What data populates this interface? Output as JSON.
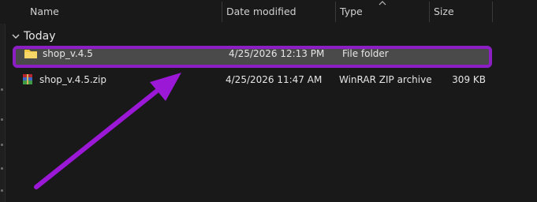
{
  "columns": {
    "name": "Name",
    "date_modified": "Date modified",
    "type": "Type",
    "size": "Size"
  },
  "group": {
    "label": "Today"
  },
  "files": [
    {
      "name": "shop_v.4.5",
      "date_modified": "4/25/2026 12:13 PM",
      "type": "File folder",
      "size": "",
      "icon": "folder-icon",
      "selected": true
    },
    {
      "name": "shop_v.4.5.zip",
      "date_modified": "4/25/2026 11:47 AM",
      "type": "WinRAR ZIP archive",
      "size": "309 KB",
      "icon": "winrar-archive-icon",
      "selected": false
    }
  ],
  "colors": {
    "background": "#191919",
    "selection_fill": "#4a4a4a",
    "highlight_outline": "#8b1fc4",
    "annotation_arrow": "#9b18d6",
    "folder_yellow": "#f2c744"
  }
}
